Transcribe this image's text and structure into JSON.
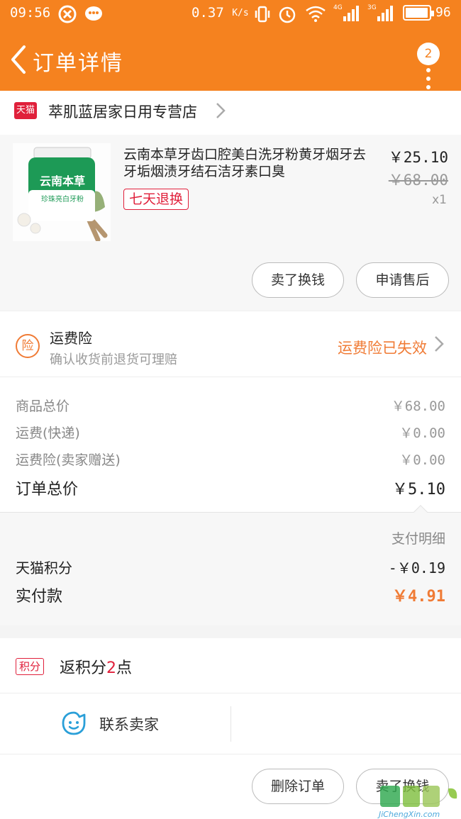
{
  "status_bar": {
    "time": "09:56",
    "speed": "0.37",
    "speed_unit": "K/s",
    "network_1": "4G",
    "network_2": "3G",
    "battery": "96",
    "battery_level": 0.96
  },
  "nav": {
    "title": "订单详情",
    "message_count": "2"
  },
  "store": {
    "badge": "天猫",
    "name": "萃肌蓝居家日用专营店"
  },
  "product": {
    "title": "云南本草牙齿口腔美白洗牙粉黄牙烟牙去牙垢烟渍牙结石洁牙素口臭",
    "image_text_1": "云南本草",
    "image_text_2": "珍珠亮白牙粉",
    "return_policy": "七天退换",
    "price": "￥25.10",
    "original_price": "￥68.00",
    "quantity": "x1",
    "sell_button": "卖了换钱",
    "after_sale_button": "申请售后"
  },
  "insurance": {
    "icon_text": "险",
    "title": "运费险",
    "subtitle": "确认收货前退货可理赔",
    "status": "运费险已失效"
  },
  "summary": {
    "rows": [
      {
        "label": "商品总价",
        "value": "￥68.00"
      },
      {
        "label": "运费(快递)",
        "value": "￥0.00"
      },
      {
        "label": "运费险(卖家赠送)",
        "value": "￥0.00"
      }
    ],
    "total_label": "订单总价",
    "total_value": "￥5.10"
  },
  "payment": {
    "detail_link": "支付明细",
    "points_label": "天猫积分",
    "points_value": "-￥0.19",
    "paid_label": "实付款",
    "paid_value": "￥4.91",
    "accent_color": "#f07b35"
  },
  "points": {
    "tag": "积分",
    "prefix": "返积分",
    "count": "2",
    "suffix": "点"
  },
  "contact": {
    "label": "联系卖家"
  },
  "actions": {
    "delete_order": "删除订单",
    "sell": "卖了换钱"
  },
  "watermark": {
    "text": "JiChengXin.com",
    "chars": "集诚信"
  }
}
